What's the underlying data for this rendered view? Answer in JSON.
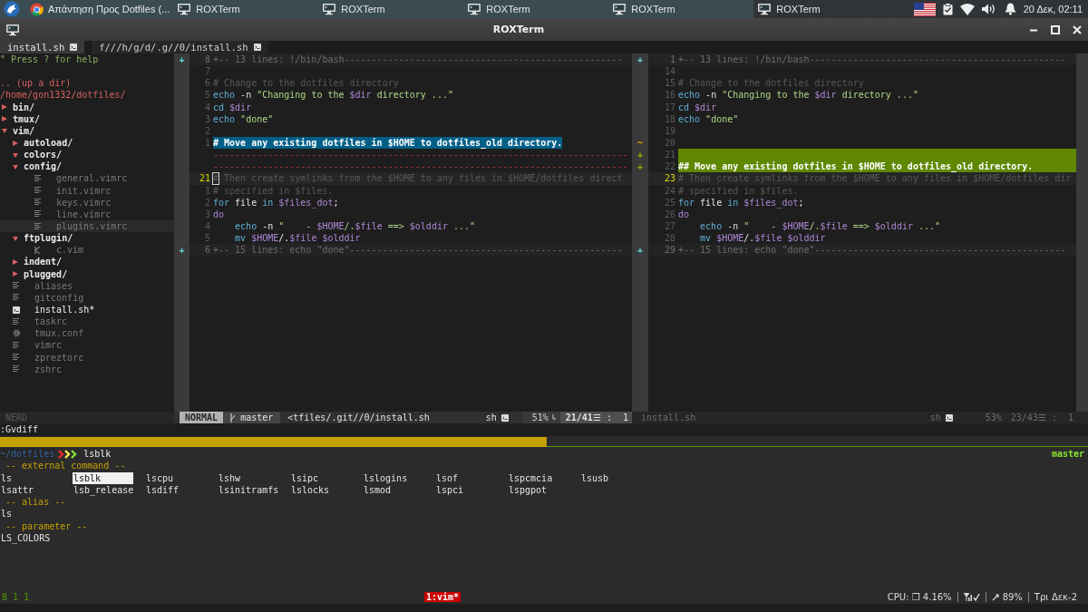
{
  "taskbar": {
    "tasks": [
      {
        "label": "Απάντηση Προς Dotfiles (...",
        "kind": "browser",
        "selected": false
      },
      {
        "label": "ROXTerm",
        "kind": "terminal",
        "selected": false
      },
      {
        "label": "ROXTerm",
        "kind": "terminal",
        "selected": false
      },
      {
        "label": "ROXTerm",
        "kind": "terminal",
        "selected": false
      },
      {
        "label": "ROXTerm",
        "kind": "terminal",
        "selected": false
      },
      {
        "label": "ROXTerm",
        "kind": "terminal",
        "selected": true
      }
    ],
    "clock": "20 Δεκ, 02:11"
  },
  "window": {
    "title": "ROXTerm"
  },
  "vim": {
    "tabs": [
      {
        "label": "install.sh",
        "selected": true
      },
      {
        "label": "f///h/g/d/.g//0/install.sh",
        "selected": false
      }
    ],
    "tree": {
      "help": "\" Press ? for help",
      "up": ".. (up a dir)",
      "root": "/home/gon1332/dotfiles/",
      "items": [
        {
          "kind": "dir",
          "name": "bin/",
          "expanded": false,
          "selected": false
        },
        {
          "kind": "dir",
          "name": "tmux/",
          "expanded": false,
          "selected": false
        },
        {
          "kind": "dir",
          "name": "vim/",
          "expanded": true,
          "selected": false,
          "children": [
            {
              "kind": "dir",
              "name": "autoload/",
              "expanded": false,
              "selected": false
            },
            {
              "kind": "dir",
              "name": "colors/",
              "expanded": true,
              "selected": false
            },
            {
              "kind": "dir",
              "name": "config/",
              "expanded": true,
              "selected": false,
              "children": [
                {
                  "kind": "text-file",
                  "name": "general.vimrc",
                  "open": false,
                  "selected": false
                },
                {
                  "kind": "text-file",
                  "name": "init.vimrc",
                  "open": false,
                  "selected": false
                },
                {
                  "kind": "text-file",
                  "name": "keys.vimrc",
                  "open": false,
                  "selected": false
                },
                {
                  "kind": "text-file",
                  "name": "line.vimrc",
                  "open": false,
                  "selected": false
                },
                {
                  "kind": "text-file",
                  "name": "plugins.vimrc",
                  "open": false,
                  "selected": true
                }
              ]
            },
            {
              "kind": "dir",
              "name": "ftplugin/",
              "expanded": true,
              "selected": false,
              "children": [
                {
                  "kind": "c-file",
                  "name": "c.vim",
                  "open": false,
                  "selected": false
                }
              ]
            },
            {
              "kind": "dir",
              "name": "indent/",
              "expanded": false,
              "selected": false
            },
            {
              "kind": "dir",
              "name": "plugged/",
              "expanded": false,
              "selected": false
            }
          ]
        },
        {
          "kind": "text-file",
          "name": "aliases",
          "open": false,
          "selected": false
        },
        {
          "kind": "text-file",
          "name": "gitconfig",
          "open": false,
          "selected": false
        },
        {
          "kind": "script-file",
          "name": "install.sh*",
          "open": true,
          "selected": false
        },
        {
          "kind": "text-file",
          "name": "taskrc",
          "open": false,
          "selected": false
        },
        {
          "kind": "config-file",
          "name": "tmux.conf",
          "open": false,
          "selected": false
        },
        {
          "kind": "text-file",
          "name": "vimrc",
          "open": false,
          "selected": false
        },
        {
          "kind": "text-file",
          "name": "zpreztorc",
          "open": false,
          "selected": false
        },
        {
          "kind": "text-file",
          "name": "zshrc",
          "open": false,
          "selected": false
        }
      ]
    },
    "panes": [
      {
        "active": true,
        "lines": [
          {
            "kind": "fold",
            "sign": "+",
            "number": "8",
            "segments": [
              {
                "kind": "fold",
                "text": "+-- 13 lines: !/bin/bash---------------------------------------------------"
              }
            ]
          },
          {
            "kind": "code",
            "number": "7"
          },
          {
            "kind": "code",
            "number": "6",
            "segments": [
              {
                "kind": "comment",
                "text": "# Change to the dotfiles directory"
              }
            ]
          },
          {
            "kind": "code",
            "number": "5",
            "segments": [
              {
                "kind": "keyword",
                "text": "echo"
              },
              {
                "kind": "plain",
                "text": " -n "
              },
              {
                "kind": "string",
                "text": "\"Changing to the "
              },
              {
                "kind": "variable",
                "text": "$dir"
              },
              {
                "kind": "string",
                "text": " directory ...\""
              }
            ]
          },
          {
            "kind": "code",
            "number": "4",
            "segments": [
              {
                "kind": "keyword",
                "text": "cd"
              },
              {
                "kind": "variable",
                "text": " $dir"
              }
            ]
          },
          {
            "kind": "code",
            "number": "3",
            "segments": [
              {
                "kind": "keyword",
                "text": "echo"
              },
              {
                "kind": "string",
                "text": " \"done\""
              }
            ]
          },
          {
            "kind": "code",
            "number": "2"
          },
          {
            "kind": "text-change",
            "number": "1",
            "segments": [
              {
                "kind": "heading",
                "text": "# Move any existing dotfiles in $HOME to dotfiles_old directory."
              }
            ]
          },
          {
            "kind": "filler",
            "segments": [
              {
                "kind": "filler",
                "text": "----------------------------------------------------------------------------"
              }
            ]
          },
          {
            "kind": "filler",
            "segments": [
              {
                "kind": "filler",
                "text": "----------------------------------------------------------------------------"
              }
            ]
          },
          {
            "kind": "current",
            "number": "21",
            "segments": [
              {
                "kind": "comment",
                "text": "# Then create symlinks from the $HOME to any files in $HOME/dotfiles direct"
              }
            ]
          },
          {
            "kind": "code",
            "number": "1",
            "segments": [
              {
                "kind": "comment",
                "text": "# specified in $files."
              }
            ]
          },
          {
            "kind": "code",
            "number": "2",
            "segments": [
              {
                "kind": "keyword",
                "text": "for"
              },
              {
                "kind": "plain",
                "text": " file "
              },
              {
                "kind": "keyword",
                "text": "in"
              },
              {
                "kind": "variable",
                "text": " $files_dot"
              },
              {
                "kind": "plain",
                "text": ";"
              }
            ]
          },
          {
            "kind": "code",
            "number": "3",
            "segments": [
              {
                "kind": "control",
                "text": "do"
              }
            ]
          },
          {
            "kind": "code",
            "number": "4",
            "segments": [
              {
                "kind": "keyword",
                "text": "    echo"
              },
              {
                "kind": "plain",
                "text": " -n "
              },
              {
                "kind": "string",
                "text": "\"    - "
              },
              {
                "kind": "variable",
                "text": "$HOME"
              },
              {
                "kind": "string",
                "text": "/."
              },
              {
                "kind": "variable",
                "text": "$file"
              },
              {
                "kind": "string",
                "text": " ==> "
              },
              {
                "kind": "variable",
                "text": "$olddir"
              },
              {
                "kind": "string",
                "text": " ...\""
              }
            ]
          },
          {
            "kind": "code",
            "number": "5",
            "segments": [
              {
                "kind": "keyword",
                "text": "    mv"
              },
              {
                "kind": "variable",
                "text": " $HOME"
              },
              {
                "kind": "plain",
                "text": "/."
              },
              {
                "kind": "variable",
                "text": "$file"
              },
              {
                "kind": "variable",
                "text": " $olddir"
              }
            ]
          },
          {
            "kind": "fold",
            "sign": "+",
            "number": "6",
            "segments": [
              {
                "kind": "fold",
                "text": "+-- 15 lines: echo \"done\"--------------------------------------------------"
              }
            ]
          }
        ]
      },
      {
        "active": false,
        "lines": [
          {
            "kind": "fold",
            "sign": "+",
            "number": "1",
            "segments": [
              {
                "kind": "fold",
                "text": "+-- 13 lines: !/bin/bash-----------------------------------------------"
              }
            ]
          },
          {
            "kind": "code",
            "number": "14"
          },
          {
            "kind": "code",
            "number": "15",
            "segments": [
              {
                "kind": "comment",
                "text": "# Change to the dotfiles directory"
              }
            ]
          },
          {
            "kind": "code",
            "number": "16",
            "segments": [
              {
                "kind": "keyword",
                "text": "echo"
              },
              {
                "kind": "plain",
                "text": " -n "
              },
              {
                "kind": "string",
                "text": "\"Changing to the "
              },
              {
                "kind": "variable",
                "text": "$dir"
              },
              {
                "kind": "string",
                "text": " directory ...\""
              }
            ]
          },
          {
            "kind": "code",
            "number": "17",
            "segments": [
              {
                "kind": "keyword",
                "text": "cd"
              },
              {
                "kind": "variable",
                "text": " $dir"
              }
            ]
          },
          {
            "kind": "code",
            "number": "18",
            "segments": [
              {
                "kind": "keyword",
                "text": "echo"
              },
              {
                "kind": "string",
                "text": " \"done\""
              }
            ]
          },
          {
            "kind": "code",
            "number": "19"
          },
          {
            "kind": "changed",
            "sign": "~",
            "number": "20"
          },
          {
            "kind": "added",
            "sign": "+",
            "number": "21"
          },
          {
            "kind": "added",
            "sign": "+",
            "number": "22",
            "segments": [
              {
                "kind": "heading",
                "text": "## Move any existing dotfiles in $HOME to dotfiles_old directory."
              }
            ]
          },
          {
            "kind": "current",
            "number": "23",
            "segments": [
              {
                "kind": "comment",
                "text": "# Then create symlinks from the $HOME to any files in $HOME/dotfiles dir"
              }
            ]
          },
          {
            "kind": "code",
            "number": "24",
            "segments": [
              {
                "kind": "comment",
                "text": "# specified in $files."
              }
            ]
          },
          {
            "kind": "code",
            "number": "25",
            "segments": [
              {
                "kind": "keyword",
                "text": "for"
              },
              {
                "kind": "plain",
                "text": " file "
              },
              {
                "kind": "keyword",
                "text": "in"
              },
              {
                "kind": "variable",
                "text": " $files_dot"
              },
              {
                "kind": "plain",
                "text": ";"
              }
            ]
          },
          {
            "kind": "code",
            "number": "26",
            "segments": [
              {
                "kind": "control",
                "text": "do"
              }
            ]
          },
          {
            "kind": "code",
            "number": "27",
            "segments": [
              {
                "kind": "keyword",
                "text": "    echo"
              },
              {
                "kind": "plain",
                "text": " -n "
              },
              {
                "kind": "string",
                "text": "\"    - "
              },
              {
                "kind": "variable",
                "text": "$HOME"
              },
              {
                "kind": "string",
                "text": "/."
              },
              {
                "kind": "variable",
                "text": "$file"
              },
              {
                "kind": "string",
                "text": " ==> "
              },
              {
                "kind": "variable",
                "text": "$olddir"
              },
              {
                "kind": "string",
                "text": " ...\""
              }
            ]
          },
          {
            "kind": "code",
            "number": "28",
            "segments": [
              {
                "kind": "keyword",
                "text": "    mv"
              },
              {
                "kind": "variable",
                "text": " $HOME"
              },
              {
                "kind": "plain",
                "text": "/."
              },
              {
                "kind": "variable",
                "text": "$file"
              },
              {
                "kind": "variable",
                "text": " $olddir"
              }
            ]
          },
          {
            "kind": "fold",
            "sign": "+",
            "number": "29",
            "segments": [
              {
                "kind": "fold",
                "text": "+-- 15 lines: echo \"done\"----------------------------------------------"
              }
            ]
          }
        ]
      }
    ],
    "statusline": {
      "tree": "NERD",
      "mode": "NORMAL",
      "branch": "master",
      "file": "<tfiles/.git//0/install.sh",
      "filetype": "sh",
      "percent": "51%",
      "position": "**21/41**☰ :  1",
      "other_file": "install.sh",
      "other_filetype": "sh",
      "other_percent": "53%",
      "other_position": "23/43☰ :  1"
    },
    "command": ":Gvdiff"
  },
  "shell": {
    "cwd": "~/dotfiles",
    "command": "lsblk",
    "branch": "master",
    "groups": [
      {
        "header": "-- external command --",
        "items": [
          {
            "label": "ls",
            "selected": false
          },
          {
            "label": "lsblk",
            "selected": true
          },
          {
            "label": "lscpu",
            "selected": false
          },
          {
            "label": "lshw",
            "selected": false
          },
          {
            "label": "lsipc",
            "selected": false
          },
          {
            "label": "lslogins",
            "selected": false
          },
          {
            "label": "lsof",
            "selected": false
          },
          {
            "label": "lspcmcia",
            "selected": false
          },
          {
            "label": "lsusb",
            "selected": false
          },
          {
            "label": "lsattr",
            "selected": false
          },
          {
            "label": "lsb_release",
            "selected": false
          },
          {
            "label": "lsdiff",
            "selected": false
          },
          {
            "label": "lsinitramfs",
            "selected": false
          },
          {
            "label": "lslocks",
            "selected": false
          },
          {
            "label": "lsmod",
            "selected": false
          },
          {
            "label": "lspci",
            "selected": false
          },
          {
            "label": "lspgpot",
            "selected": false
          }
        ]
      },
      {
        "header": "-- alias --",
        "items": [
          {
            "label": "ls",
            "selected": false
          }
        ]
      },
      {
        "header": "-- parameter --",
        "items": [
          {
            "label": "LS_COLORS",
            "selected": false
          }
        ]
      }
    ]
  },
  "tmux": {
    "sessions": "8 1 1",
    "window": "1:vim*",
    "cpu": "CPU: ❐ 4.16%",
    "battery": "89%",
    "date": "Τρι Δεκ-2"
  }
}
